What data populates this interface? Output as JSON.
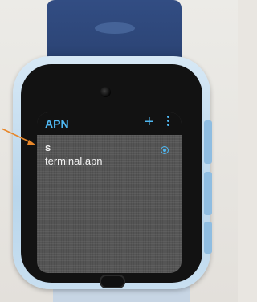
{
  "screen": {
    "title": "APN",
    "add_icon": "+",
    "more_icon": "more-vert-icon",
    "apn_list": [
      {
        "name": "s",
        "apn": "terminal.apn",
        "selected": true
      }
    ]
  },
  "colors": {
    "accent": "#4fb8f2",
    "annotation": "#e8872a",
    "strap": "#2d4678",
    "case": "#c8dff0"
  }
}
